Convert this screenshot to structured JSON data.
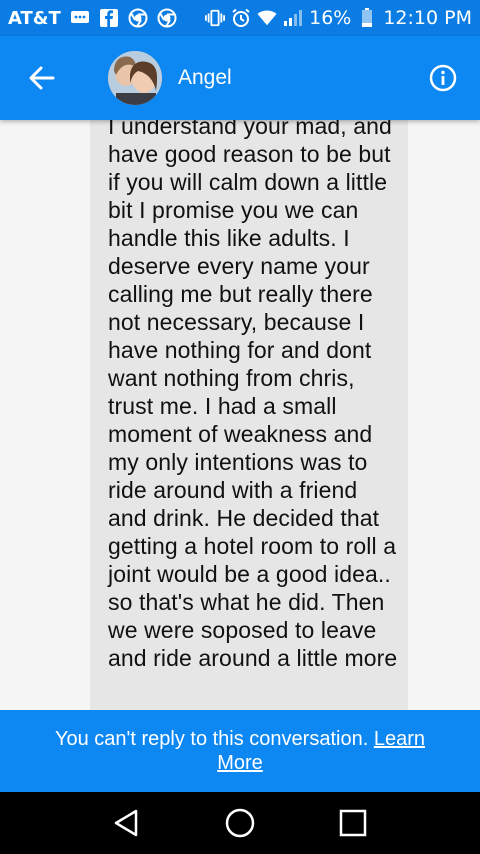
{
  "status_bar": {
    "carrier": "AT&T",
    "battery": "16%",
    "time": "12:10 PM"
  },
  "header": {
    "contact_name": "Angel"
  },
  "message": {
    "text": "I understand your mad, and have good reason to be but if you will calm down a little bit I promise you we can handle this like adults. I deserve every name your calling me but really there not necessary, because I have nothing for and dont want nothing from chris, trust me. I had a small moment of weakness and my only intentions was to ride around with a friend and drink. He decided that getting a hotel room to roll a joint would be a good idea.. so that's what he did. Then we were soposed to leave and ride around a little more"
  },
  "banner": {
    "text": "You can't reply to this conversation.",
    "link": "Learn More"
  },
  "colors": {
    "accent": "#0d87f2",
    "status_bar": "#0a7ce3",
    "bubble": "#e6e6e6"
  }
}
